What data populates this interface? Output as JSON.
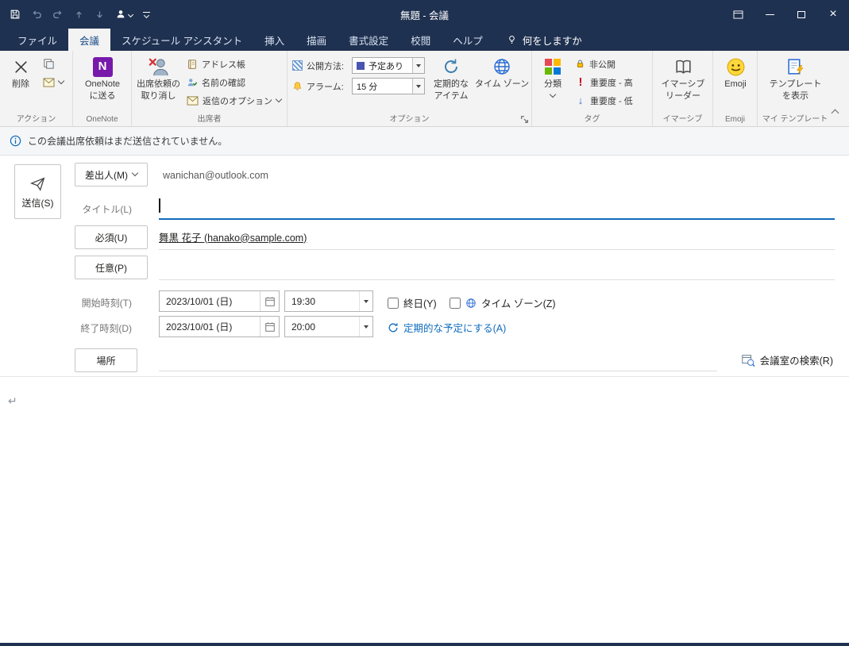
{
  "colors": {
    "titlebar_bg": "#1f3150",
    "ribbon_bg": "#f3f3f3",
    "accent_blue": "#0f6cbd",
    "busy_square": "#4a54b2",
    "onenote_purple": "#7719aa"
  },
  "titlebar": {
    "title": "無題 - 会議"
  },
  "tabs": [
    {
      "label": "ファイル"
    },
    {
      "label": "会議",
      "active": true
    },
    {
      "label": "スケジュール アシスタント"
    },
    {
      "label": "挿入"
    },
    {
      "label": "描画"
    },
    {
      "label": "書式設定"
    },
    {
      "label": "校閲"
    },
    {
      "label": "ヘルプ"
    }
  ],
  "tell_me": "何をしますか",
  "ribbon": {
    "actions": {
      "caption": "アクション",
      "delete": "削除"
    },
    "onenote": {
      "caption": "OneNote",
      "send_line1": "OneNote",
      "send_line2": "に送る"
    },
    "attendees": {
      "caption": "出席者",
      "cancel_line1": "出席依頼の",
      "cancel_line2": "取り消し",
      "address_book": "アドレス帳",
      "check_names": "名前の確認",
      "response_options": "返信のオプション"
    },
    "options": {
      "caption": "オプション",
      "show_as_label": "公開方法:",
      "show_as_value": "予定あり",
      "reminder_label": "アラーム:",
      "reminder_value": "15 分",
      "recurring_line1": "定期的な",
      "recurring_line2": "アイテム",
      "time_zones": "タイム ゾーン"
    },
    "tags": {
      "caption": "タグ",
      "categorize": "分類",
      "private": "非公開",
      "importance_high": "重要度 - 高",
      "importance_low": "重要度 - 低"
    },
    "immersive": {
      "caption": "イマーシブ",
      "reader_line1": "イマーシブ",
      "reader_line2": "リーダー"
    },
    "emoji": {
      "caption": "Emoji",
      "button": "Emoji"
    },
    "templates": {
      "caption": "マイ テンプレート",
      "view_line1": "テンプレート",
      "view_line2": "を表示"
    }
  },
  "infobar": {
    "message": "この会議出席依頼はまだ送信されていません。"
  },
  "form": {
    "send": "送信(S)",
    "from_label": "差出人(M)",
    "from_value": "wanichan@outlook.com",
    "title_label": "タイトル(L)",
    "required_label": "必須(U)",
    "required_value": "舞黒 花子 (hanako@sample.com)",
    "optional_label": "任意(P)",
    "start_label": "開始時刻(T)",
    "start_date": "2023/10/01 (日)",
    "start_time": "19:30",
    "allday": "終日(Y)",
    "timezone": "タイム ゾーン(Z)",
    "end_label": "終了時刻(D)",
    "end_date": "2023/10/01 (日)",
    "end_time": "20:00",
    "recurrence": "定期的な予定にする(A)",
    "location_label": "場所",
    "room_finder": "会議室の検索(R)"
  },
  "body": {
    "mark": "↵"
  }
}
